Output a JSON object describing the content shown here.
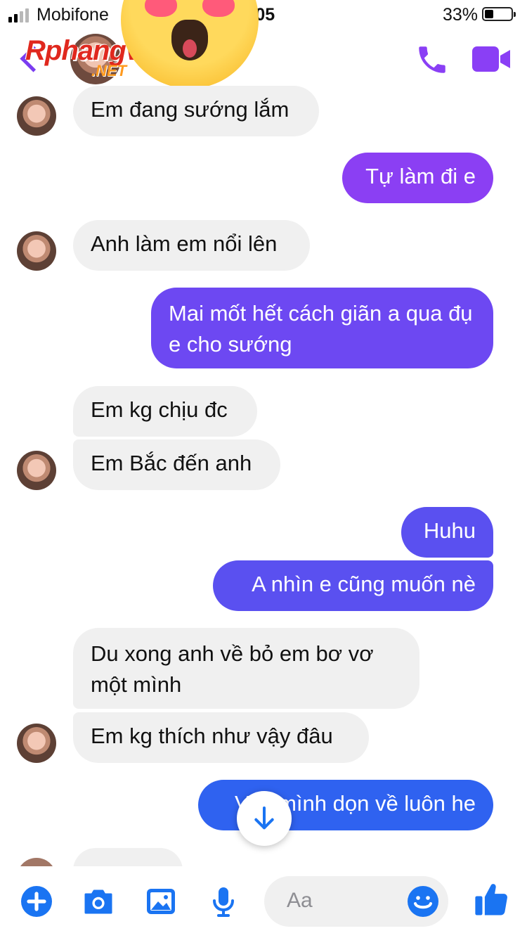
{
  "status_bar": {
    "carrier": "Mobifone",
    "time": "3:05",
    "time_visible": ":05",
    "battery_percent": "33%",
    "battery_level": 0.33,
    "signal_bars_filled": 2,
    "signal_bars_total": 4
  },
  "header": {
    "watermark_logo": "Rphangvn",
    "watermark_suffix": ".NET",
    "emoji_overlay": "heart-eyes-emoji",
    "call_icon": "phone-icon",
    "video_icon": "video-camera-icon",
    "accent_color": "#8a3ff5"
  },
  "messages": [
    {
      "side": "in",
      "text": "Em đang sướng lắm",
      "avatar": true
    },
    {
      "side": "out",
      "text": "Tự làm đi e",
      "color": "#8b3ff3"
    },
    {
      "side": "in",
      "text": "Anh làm em nổi lên",
      "avatar": true
    },
    {
      "side": "out",
      "text": "Mai mốt hết cách giãn a qua đụ e cho sướng",
      "color": "#6d48f2"
    },
    {
      "side": "in",
      "text": "Em kg chịu đc",
      "avatar": false
    },
    {
      "side": "in",
      "text": "Em Bắc đến anh",
      "avatar": true
    },
    {
      "side": "out",
      "text": "Huhu",
      "color": "#5a50f0"
    },
    {
      "side": "out",
      "text": "A nhìn e cũng muốn nè",
      "color": "#5a50f0"
    },
    {
      "side": "in",
      "text": "Du xong anh về bỏ em bơ vơ một mình",
      "avatar": false
    },
    {
      "side": "in",
      "text": "Em kg thích như vậy đâu",
      "avatar": true
    },
    {
      "side": "out",
      "text": "Vậy mình dọn về luôn he",
      "color": "#2f62f0"
    }
  ],
  "composer": {
    "placeholder": "Aa",
    "icons": [
      "plus-icon",
      "camera-icon",
      "gallery-icon",
      "microphone-icon",
      "emoji-icon",
      "like-icon"
    ],
    "accent_color": "#1a74f2"
  },
  "scroll_to_bottom_icon": "arrow-down-icon"
}
